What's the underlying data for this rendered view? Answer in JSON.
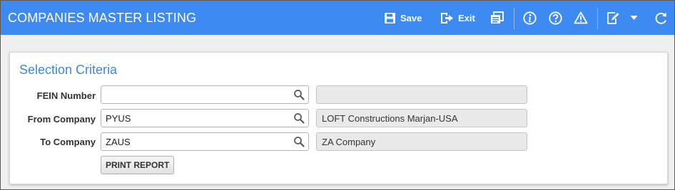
{
  "header": {
    "title": "COMPANIES MASTER LISTING",
    "save_label": "Save",
    "exit_label": "Exit",
    "background_color": "#3d8bf2"
  },
  "toolbar_icons": [
    "save-icon",
    "exit-icon",
    "copy-icon",
    "info-icon",
    "help-icon",
    "warning-icon",
    "edit-icon",
    "chevron-down-icon",
    "refresh-icon"
  ],
  "section": {
    "title": "Selection Criteria"
  },
  "fields": [
    {
      "label": "FEIN Number",
      "value": "",
      "description": ""
    },
    {
      "label": "From Company",
      "value": "PYUS",
      "description": "LOFT Constructions Marjan-USA"
    },
    {
      "label": "To Company",
      "value": "ZAUS",
      "description": "ZA Company"
    }
  ],
  "print_button": {
    "label": "PRINT REPORT"
  }
}
